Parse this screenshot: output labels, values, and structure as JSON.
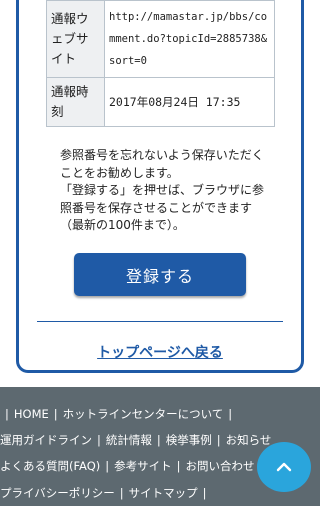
{
  "info_table": {
    "rows": [
      {
        "label": "通報ウェブサイト",
        "value": "http://mamastar.jp/bbs/comment.do?topicId=2885738&sort=0"
      },
      {
        "label": "通報時刻",
        "value": "2017年08月24日 17:35"
      }
    ]
  },
  "notice": {
    "line1": "参照番号を忘れないよう保存いただくことをお勧めします。",
    "line2": "「登録する」を押せば、ブラウザに参照番号を保存させることができます（最新の100件まで）。"
  },
  "register_button": {
    "label": "登録する"
  },
  "top_link": {
    "label": "トップページへ戻る"
  },
  "footer": {
    "line1": [
      "HOME",
      "ホットラインセンターについて"
    ],
    "line2": [
      "運用ガイドライン",
      "統計情報",
      "検挙事例",
      "お知らせ"
    ],
    "line3": [
      "よくある質問(FAQ)",
      "参考サイト",
      "お問い合わせ"
    ],
    "line4": [
      "プライバシーポリシー",
      "サイトマップ"
    ]
  },
  "icons": {
    "scroll_top": "chevron-up-icon"
  },
  "colors": {
    "accent": "#1f5aa6",
    "footer_bg": "#5d6970",
    "scroll_button": "#2aa5dc"
  }
}
